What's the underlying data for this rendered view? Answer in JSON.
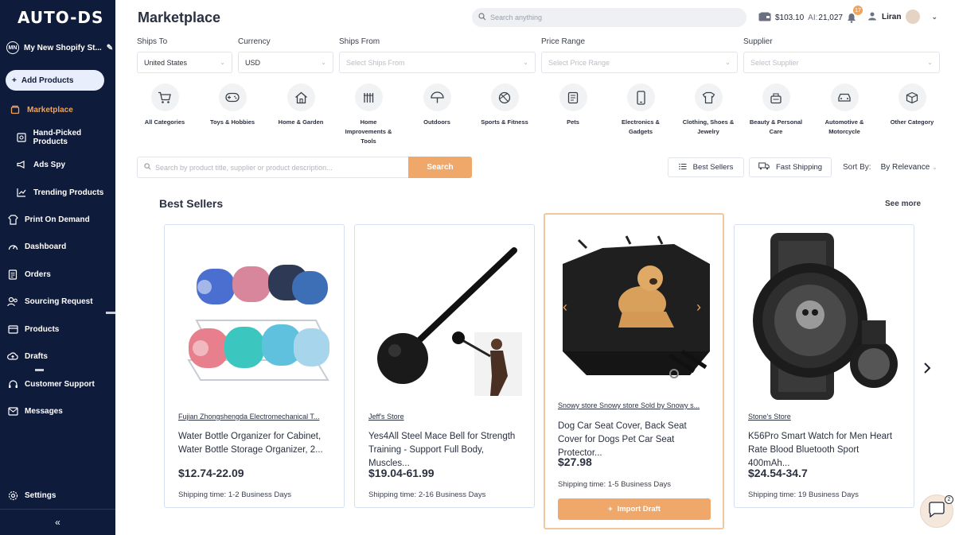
{
  "sidebar": {
    "logo": "AUTO-DS",
    "store": {
      "initials": "MN",
      "name": "My New Shopify St..."
    },
    "add_products": "Add Products",
    "items": [
      {
        "label": "Marketplace"
      },
      {
        "label": "Hand-Picked Products"
      },
      {
        "label": "Ads Spy"
      },
      {
        "label": "Trending Products"
      },
      {
        "label": "Print On Demand"
      },
      {
        "label": "Dashboard"
      },
      {
        "label": "Orders"
      },
      {
        "label": "Sourcing Request"
      },
      {
        "label": "Products"
      },
      {
        "label": "Drafts"
      },
      {
        "label": "Customer Support"
      },
      {
        "label": "Messages"
      },
      {
        "label": "Settings"
      }
    ],
    "collapse": "«"
  },
  "header": {
    "title": "Marketplace",
    "search_placeholder": "Search anything",
    "balance": "$103.10",
    "ai_label": "AI:",
    "ai_credits": "21,027",
    "notifications": "17",
    "user": "Liran"
  },
  "filters": [
    {
      "label": "Ships To",
      "value": "United States",
      "placeholder": false
    },
    {
      "label": "Currency",
      "value": "USD",
      "placeholder": false
    },
    {
      "label": "Ships From",
      "value": "Select Ships From",
      "placeholder": true
    },
    {
      "label": "Price Range",
      "value": "Select Price Range",
      "placeholder": true
    },
    {
      "label": "Supplier",
      "value": "Select Supplier",
      "placeholder": true
    }
  ],
  "categories": [
    {
      "label": "All Categories",
      "icon": "cart-icon"
    },
    {
      "label": "Toys & Hobbies",
      "icon": "gamepad-icon"
    },
    {
      "label": "Home & Garden",
      "icon": "house-icon"
    },
    {
      "label": "Home Improvements & Tools",
      "icon": "tools-icon"
    },
    {
      "label": "Outdoors",
      "icon": "umbrella-icon"
    },
    {
      "label": "Sports & Fitness",
      "icon": "ball-icon"
    },
    {
      "label": "Pets",
      "icon": "pets-icon"
    },
    {
      "label": "Electronics & Gadgets",
      "icon": "phone-icon"
    },
    {
      "label": "Clothing, Shoes & Jewelry",
      "icon": "shirt-icon"
    },
    {
      "label": "Beauty & Personal Care",
      "icon": "beauty-icon"
    },
    {
      "label": "Automotive & Motorcycle",
      "icon": "car-icon"
    },
    {
      "label": "Other Category",
      "icon": "box-icon"
    }
  ],
  "search": {
    "placeholder": "Search by product title, supplier or product description...",
    "button": "Search",
    "best_sellers": "Best Sellers",
    "fast_shipping": "Fast Shipping",
    "sort_label": "Sort By:",
    "sort_value": "By Relevance"
  },
  "section": {
    "title": "Best Sellers",
    "see_more": "See more"
  },
  "products": [
    {
      "store": "Fujian Zhongshengda Electromechanical T...",
      "title": "Water Bottle Organizer for Cabinet, Water Bottle Storage Organizer, 2...",
      "price": "$12.74-22.09",
      "shipping": "Shipping time: 1-2 Business Days"
    },
    {
      "store": "Jeff's Store",
      "title": "Yes4All Steel Mace Bell for Strength Training - Support Full Body, Muscles...",
      "price": "$19.04-61.99",
      "shipping": "Shipping time: 2-16 Business Days"
    },
    {
      "store": "Snowy store Snowy store Sold by Snowy s...",
      "title": "Dog Car Seat Cover, Back Seat Cover for Dogs Pet Car Seat Protector...",
      "price": "$27.98",
      "shipping": "Shipping time: 1-5 Business Days",
      "action": "Import Draft"
    },
    {
      "store": "Stone's Store",
      "title": "K56Pro Smart Watch for Men Heart Rate Blood Bluetooth Sport 400mAh...",
      "price": "$24.54-34.7",
      "shipping": "Shipping time: 19 Business Days"
    }
  ],
  "chat_badge": "2"
}
